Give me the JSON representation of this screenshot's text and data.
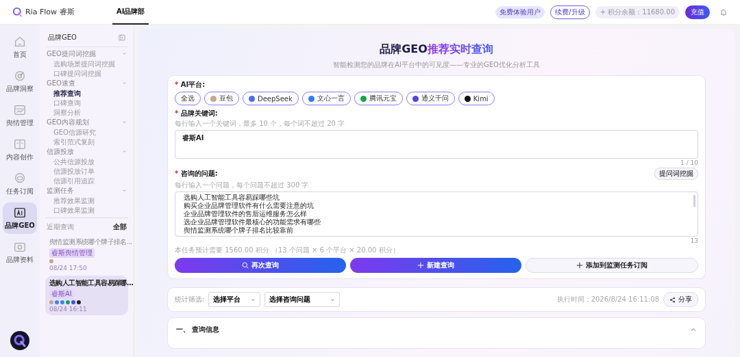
{
  "topbar": {
    "brand": "Ria Flow 睿斯",
    "tabs": [
      {
        "label": "AI品牌部",
        "selected": true
      }
    ],
    "plan_badge": "免费体验用户",
    "upgrade_button": "续费/升级",
    "points": "+ 积分余额：11680.00",
    "recharge_button": "充值"
  },
  "rail": [
    {
      "label": "首页",
      "selected": false
    },
    {
      "label": "品牌洞察",
      "selected": false
    },
    {
      "label": "舆情管理",
      "selected": false
    },
    {
      "label": "内容创作",
      "selected": false
    },
    {
      "label": "任务订阅",
      "selected": false
    },
    {
      "label": "品牌GEO",
      "selected": true
    },
    {
      "label": "品牌资料",
      "selected": false
    }
  ],
  "submenu": {
    "title": "品牌GEO",
    "groups": [
      {
        "label": "GEO提问词挖掘",
        "expanded": true,
        "items": [
          {
            "label": "选购场景提问词挖掘",
            "selected": false
          },
          {
            "label": "口碑提问词挖掘",
            "selected": false
          }
        ]
      },
      {
        "label": "GEO速查",
        "expanded": true,
        "items": [
          {
            "label": "推荐查询",
            "selected": true
          },
          {
            "label": "口碑查询",
            "selected": false
          },
          {
            "label": "洞察分析",
            "selected": false
          }
        ]
      },
      {
        "label": "GEO内容规划",
        "expanded": true,
        "items": [
          {
            "label": "GEO信源研究",
            "selected": false
          },
          {
            "label": "索引范式复刻",
            "selected": false
          }
        ]
      },
      {
        "label": "信源投放",
        "expanded": true,
        "items": [
          {
            "label": "公共信源投放",
            "selected": false
          },
          {
            "label": "信源投放订单",
            "selected": false
          },
          {
            "label": "信源引用追踪",
            "selected": false
          }
        ]
      },
      {
        "label": "监测任务",
        "expanded": true,
        "items": [
          {
            "label": "推荐效果监测",
            "selected": false
          },
          {
            "label": "口碑效果监测",
            "selected": false
          }
        ]
      }
    ],
    "recent_title": "近期查询",
    "recent_all": "全部",
    "recent": [
      {
        "title": "舆情监测系统哪个牌子排名...",
        "tag": "睿斯舆情管理",
        "platforms": [
          {
            "color": "#c9a58a"
          }
        ],
        "time": "08/24 17:50",
        "selected": false
      },
      {
        "title": "选购人工智能工具容易踩哪...",
        "tag": "睿斯AI",
        "platforms": [
          {
            "color": "#c9a58a"
          },
          {
            "color": "#4a7cf0"
          },
          {
            "color": "#3b82f6"
          },
          {
            "color": "#16a34a"
          },
          {
            "color": "#4f46e5"
          },
          {
            "color": "#222222"
          }
        ],
        "time": "08/24 16:11",
        "selected": true
      }
    ]
  },
  "header": {
    "title_lead": "品牌GEO",
    "title_accent": "推荐实时查询",
    "subtitle": "智能检测您的品牌在AI平台中的可见度——专业的GEO优化分析工具"
  },
  "form": {
    "platforms_label": {
      "mark": "*",
      "text": "AI平台:"
    },
    "platforms": [
      {
        "label": "全选",
        "selected": true
      },
      {
        "label": "豆包",
        "selected": true,
        "color": "#c9a58a"
      },
      {
        "label": "DeepSeek",
        "selected": true,
        "color": "#4a6cf7"
      },
      {
        "label": "文心一言",
        "selected": true,
        "color": "#2f7cf6"
      },
      {
        "label": "腾讯元宝",
        "selected": true,
        "color": "#16a34a"
      },
      {
        "label": "通义千问",
        "selected": true,
        "color": "#4f46e5"
      },
      {
        "label": "Kimi",
        "selected": true,
        "color": "#111111"
      }
    ],
    "keywords_label": {
      "mark": "*",
      "text": "品牌关键词:"
    },
    "keywords_hint": "每行输入一个关键词，最多 10 个，每个词不超过 20 字",
    "keywords_value": "睿斯AI",
    "keywords_count": "1 / 10",
    "questions_label": {
      "mark": "*",
      "text": "咨询的问题:"
    },
    "mine_button": "提问词挖掘",
    "questions_hint": "每行输入一个问题，每个问题不超过 300 字",
    "questions": [
      "选购人工智能工具容易踩哪些坑",
      "购买企业品牌管理软件有什么需要注意的坑",
      "企业品牌管理软件的售后运维服务怎么样",
      "选企业品牌管理软件最核心的功能需求有哪些",
      "舆情监测系统哪个牌子排名比较靠前"
    ],
    "questions_count": "13",
    "cost": "本任务预计需要 1560.00 积分 （13 个问题 × 6 个平台 × 20.00 积分）",
    "requery_button": "再次查询",
    "new_button": "新建查询",
    "subscribe_button": "添加到监测任务订阅"
  },
  "filter": {
    "label": "统计筛选:",
    "platform_select": "选择平台",
    "question_select": "选择咨询问题",
    "exec_time": "执行时间：2026/8/24 16:11:08",
    "share_button": "分享"
  },
  "section": {
    "title": "一、 查询信息",
    "expanded": true
  }
}
